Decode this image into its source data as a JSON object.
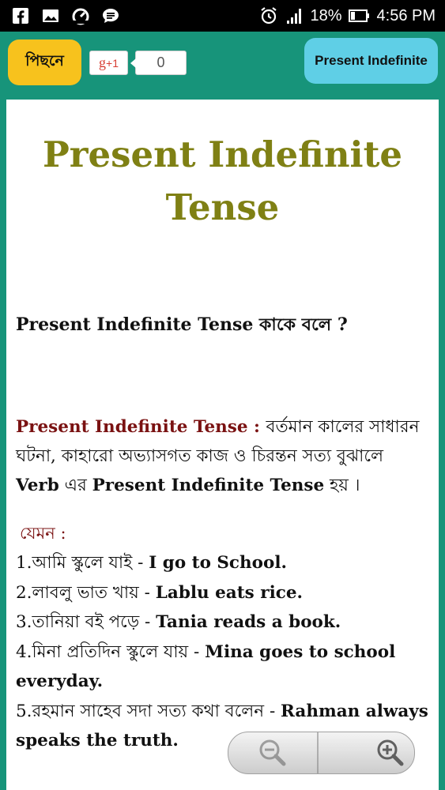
{
  "status_bar": {
    "battery_percent": "18%",
    "time": "4:56 PM"
  },
  "toolbar": {
    "back_label": "পিছনে",
    "gplus_g": "g",
    "gplus_plus": "+1",
    "gplus_count": "0",
    "topic_label": "Present Indefinite"
  },
  "content": {
    "title_line1": "Present Indefinite",
    "title_line2": "Tense",
    "question": "Present Indefinite Tense কাকে বলে ?",
    "definition": {
      "term": "Present Indefinite Tense",
      "colon": " : ",
      "text1": "বর্তমান কালের সাধারন ঘটনা, কাহারো অভ্যাসগত কাজ ও চিরন্তন সত্য বুঝালে ",
      "verb": "Verb",
      "text2": " এর ",
      "tense": "Present Indefinite Tense",
      "text3": " হয় ।"
    },
    "example_heading": "যেমন :",
    "examples": [
      {
        "bn": "1.আমি স্কুলে যাই - ",
        "en": "I go to School."
      },
      {
        "bn": "2.লাবলু ভাত খায় - ",
        "en": "Lablu eats rice."
      },
      {
        "bn": "3.তানিয়া বই পড়ে - ",
        "en": "Tania reads a book."
      },
      {
        "bn": "4.মিনা প্রতিদিন স্কুলে যায় - ",
        "en": "Mina goes to school everyday."
      },
      {
        "bn": "5.রহমান সাহেব সদা সত্য কথা বলেন - ",
        "en": "Rahman always speaks the truth."
      }
    ]
  },
  "zoom": {
    "out_icon": "zoom-out-icon",
    "in_icon": "zoom-in-icon"
  }
}
